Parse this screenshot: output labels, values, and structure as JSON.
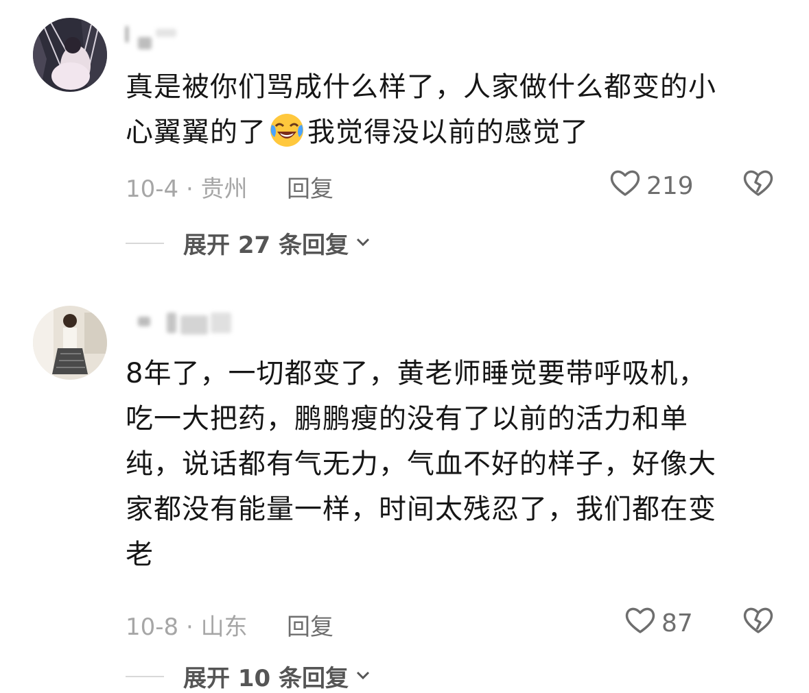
{
  "comments": [
    {
      "text_lines": [
        "真是被你们骂成什么样了，人家做什么都变的小",
        "心翼翼的了",
        "我觉得没以前的感觉了"
      ],
      "emoji": "crying-laughing-emoji",
      "date_location": "10-4 · 贵州",
      "reply_label": "回复",
      "likes": "219",
      "expand_label": "展开 27 条回复"
    },
    {
      "text_lines": [
        "8年了，一切都变了，黄老师睡觉要带呼吸机，",
        "吃一大把药，鹏鹏瘦的没有了以前的活力和单",
        "纯，说话都有气无力，气血不好的样子，好像大",
        "家都没有能量一样，时间太残忍了，我们都在变",
        "老"
      ],
      "date_location": "10-8 · 山东",
      "reply_label": "回复",
      "likes": "87",
      "expand_label": "展开 10 条回复"
    }
  ],
  "colors": {
    "text": "#161616",
    "meta": "#a6a6a6",
    "action": "#6e6e6e"
  }
}
